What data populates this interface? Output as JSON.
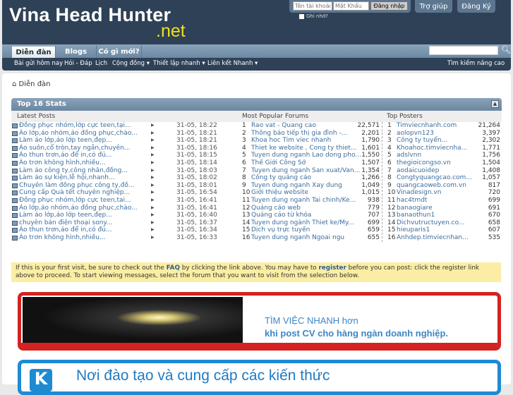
{
  "header": {
    "logo": "Vina Head Hunter",
    "logo_suffix": ".net",
    "username_placeholder": "Tên tài khoản",
    "password_placeholder": "Mật Khẩu",
    "login_button": "Đăng nhập",
    "remember": "Ghi nhớ?",
    "help": "Trợ giúp",
    "register": "Đăng Ký"
  },
  "nav": {
    "tabs": [
      "Diễn đàn",
      "Blogs",
      "Có gì mới?"
    ],
    "sub": [
      "Bài gửi hôm nay",
      "Hỏi - Đáp",
      "Lịch",
      "Cộng đồng ▾",
      "Thiết lập nhanh ▾",
      "Liên kết Nhanh ▾"
    ],
    "advanced_search": "Tìm kiếm nâng cao"
  },
  "breadcrumb": "Diễn đàn",
  "stats": {
    "title": "Top 16 Stats",
    "headers": [
      "Latest Posts",
      "Most Popular Forums",
      "Top Posters"
    ],
    "latest": [
      [
        "Đồng phục nhóm,lớp cực teen,tại...",
        "31-05, 18:22"
      ],
      [
        "Áo lớp,áo nhóm,áo đồng phục,chào...",
        "31-05, 18:21"
      ],
      [
        "Làm áo lớp,áo lớp teen,đẹp...",
        "31-05, 18:21"
      ],
      [
        "Áo suôn,cổ tròn,tay ngắn,chuyên...",
        "31-05, 18:16"
      ],
      [
        "Áo thun trơn,áo để in,có đủ...",
        "31-05, 18:15"
      ],
      [
        "Áo trơn không hình,nhiều...",
        "31-05, 18:14"
      ],
      [
        "Làm áo công ty,công nhân,đồng...",
        "31-05, 18:03"
      ],
      [
        "Làm áo sự kiện,lễ hội,nhanh...",
        "31-05, 18:02"
      ],
      [
        "Chuyên làm đồng phục công ty,đồ...",
        "31-05, 18:01"
      ],
      [
        "Cung cấp Quà tết chuyên nghiệp...",
        "31-05, 16:54"
      ],
      [
        "Đồng phục nhóm,lớp cực teen,tai...",
        "31-05, 16:41"
      ],
      [
        "Áo lớp,áo nhóm,áo đồng phục,chào...",
        "31-05, 16:41"
      ],
      [
        "Làm áo lớp,áo lớp teen,đẹp...",
        "31-05, 16:40"
      ],
      [
        "chuyên bán điện thoại sony...",
        "31-05, 16:37"
      ],
      [
        "Áo thun trơn,áo để in,có đủ...",
        "31-05, 16:34"
      ],
      [
        "Áo trơn không hình,nhiều...",
        "31-05, 16:33"
      ]
    ],
    "forums": [
      [
        "Rao vat - Quang cao",
        "22,571"
      ],
      [
        "Thông báo tiếp thị gia đình -...",
        "2,201"
      ],
      [
        "Khoa hoc Tim viec nhanh",
        "1,790"
      ],
      [
        "Thiet ke website , Cong ty thiet...",
        "1,601"
      ],
      [
        "Tuyen dung nganh Lao dong pho...",
        "1,550"
      ],
      [
        "Thế Giới Công Sở",
        "1,507"
      ],
      [
        "Tuyen dung nganh San xuat/Van...",
        "1,354"
      ],
      [
        "Công ty quảng cáo",
        "1,266"
      ],
      [
        "Tuyen dung nganh Xay dung",
        "1,049"
      ],
      [
        "Giới thiệu website",
        "1,015"
      ],
      [
        "Tuyen dung nganh Tai chinh/Ke...",
        "938"
      ],
      [
        "Quảng cáo web",
        "779"
      ],
      [
        "Quảng cáo từ khóa",
        "707"
      ],
      [
        "Tuyen dung ngành Thiet ke/My...",
        "699"
      ],
      [
        "Dịch vụ trực tuyến",
        "659"
      ],
      [
        "Tuyen dung nganh Ngoai ngu",
        "655"
      ]
    ],
    "posters": [
      [
        "Timviecnhanh.com",
        "21,264"
      ],
      [
        "aolopvn123",
        "3,397"
      ],
      [
        "Công ty tuyển...",
        "2,302"
      ],
      [
        "Khoahoc.timviecnha...",
        "1,771"
      ],
      [
        "adslvnn",
        "1,756"
      ],
      [
        "thegioicongso.vn",
        "1,504"
      ],
      [
        "aodaicuoidep",
        "1,408"
      ],
      [
        "Congtyquangcao.com...",
        "1,057"
      ],
      [
        "quangcaoweb.com.vn",
        "817"
      ],
      [
        "Vinadesign.vn",
        "720"
      ],
      [
        "hac4tmdt",
        "699"
      ],
      [
        "banaogiare",
        "691"
      ],
      [
        "banaothun1",
        "670"
      ],
      [
        "Dichvutructuyen.co...",
        "658"
      ],
      [
        "hieuparis1",
        "607"
      ],
      [
        "Anhdep.timviecnhan...",
        "535"
      ]
    ]
  },
  "notice": {
    "p1": "If this is your first visit, be sure to check out the ",
    "faq": "FAQ",
    "p2": " by clicking the link above. You may have to ",
    "register": "register",
    "p3": " before you can post: click the register link above to proceed. To start viewing messages, select the forum that you want to visit from the selection below."
  },
  "banner1": {
    "line1": "TÌM VIỆC NHANH hơn",
    "line2": "khi post CV cho hàng ngàn doanh nghiệp."
  },
  "banner2": {
    "text": "Nơi đào tạo và cung cấp các kiến thức"
  }
}
